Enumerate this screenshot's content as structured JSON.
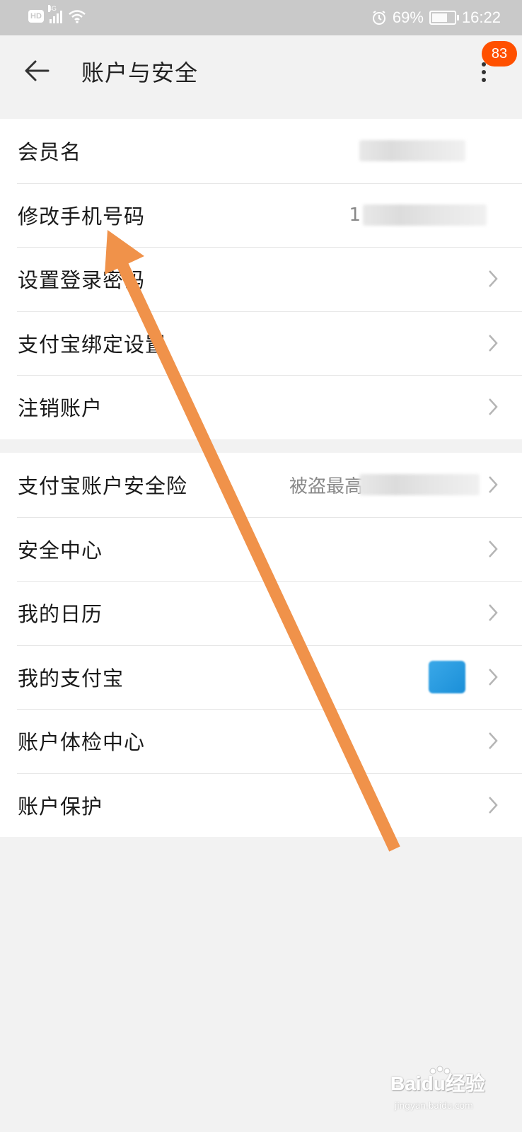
{
  "status_bar": {
    "hd": "HD",
    "network": "4G",
    "battery_percent": "69%",
    "time": "16:22",
    "battery_level": 0.69
  },
  "header": {
    "title": "账户与安全",
    "notification_count": "83"
  },
  "group1": {
    "items": [
      {
        "label": "会员名",
        "value": ""
      },
      {
        "label": "修改手机号码",
        "value": "1"
      },
      {
        "label": "设置登录密码",
        "value": ""
      },
      {
        "label": "支付宝绑定设置",
        "value": ""
      },
      {
        "label": "注销账户",
        "value": ""
      }
    ]
  },
  "group2": {
    "items": [
      {
        "label": "支付宝账户安全险",
        "value": "被盗最高"
      },
      {
        "label": "安全中心",
        "value": ""
      },
      {
        "label": "我的日历",
        "value": ""
      },
      {
        "label": "我的支付宝",
        "value": ""
      },
      {
        "label": "账户体检中心",
        "value": ""
      },
      {
        "label": "账户保护",
        "value": ""
      }
    ]
  },
  "watermark": {
    "brand": "Baidu经验",
    "url": "jingyan.baidu.com"
  },
  "colors": {
    "accent": "#ff5000",
    "annotation_arrow": "#f0924a",
    "status_bar_bg": "#c9c9c9"
  },
  "icons": [
    "hd-icon",
    "signal-icon",
    "wifi-icon",
    "alarm-icon",
    "battery-icon",
    "back-arrow-icon",
    "more-vertical-icon",
    "chevron-right-icon"
  ]
}
